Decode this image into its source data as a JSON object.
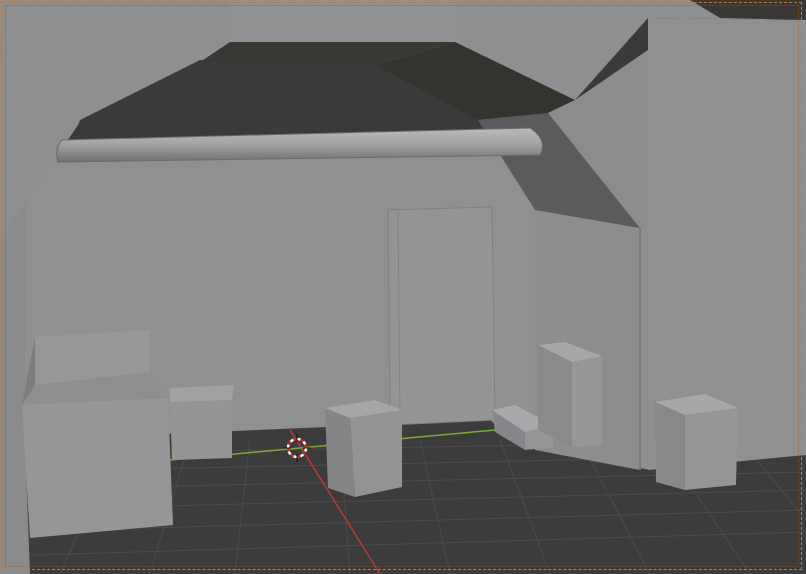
{
  "viewport": {
    "mode": "Object Mode",
    "shading": "solid",
    "colors": {
      "background": "#3a3a3a",
      "grid_line": "#4a4a4a",
      "axis_x": "#b83a3a",
      "axis_y": "#7ea83a",
      "wall": "#909193",
      "wall_dark": "#8a8b8d",
      "ceiling_dark": "#353330",
      "camera_frame": "#c9772e"
    },
    "objects": [
      "ceiling",
      "left-wall",
      "back-wall",
      "right-pillar",
      "pipe",
      "doorway",
      "sofa",
      "small-box-left",
      "center-box",
      "tall-box",
      "low-box",
      "right-box",
      "3d-cursor"
    ]
  }
}
